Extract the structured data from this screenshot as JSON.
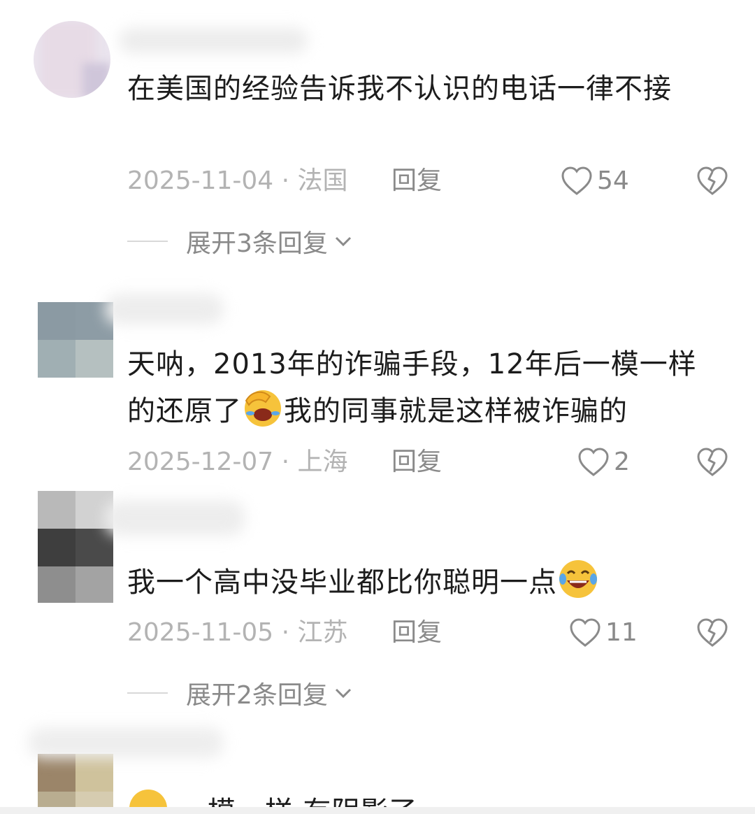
{
  "comments": [
    {
      "text": "在美国的经验告诉我不认识的电话一律不接",
      "date_loc": "2025-11-04 · 法国",
      "reply": "回复",
      "likes": "54",
      "expand": "展开3条回复"
    },
    {
      "text_before": "天呐，2013年的诈骗手段，12年后一模一样的还原了",
      "text_after": "我的同事就是这样被诈骗的",
      "emoji": "facepalm-laugh",
      "date_loc": "2025-12-07 · 上海",
      "reply": "回复",
      "likes": "2"
    },
    {
      "text_before": "我一个高中没毕业都比你聪明一点",
      "emoji": "laugh-tears",
      "date_loc": "2025-11-05 · 江苏",
      "reply": "回复",
      "likes": "11",
      "expand": "展开2条回复"
    },
    {
      "text_partial": "一模一样 有阴影了"
    }
  ],
  "colors": {
    "meta_gray": "#b3b3b3",
    "action_gray": "#8a8a8a",
    "text": "#1c1c1c",
    "emoji_yellow": "#f6c33b"
  }
}
